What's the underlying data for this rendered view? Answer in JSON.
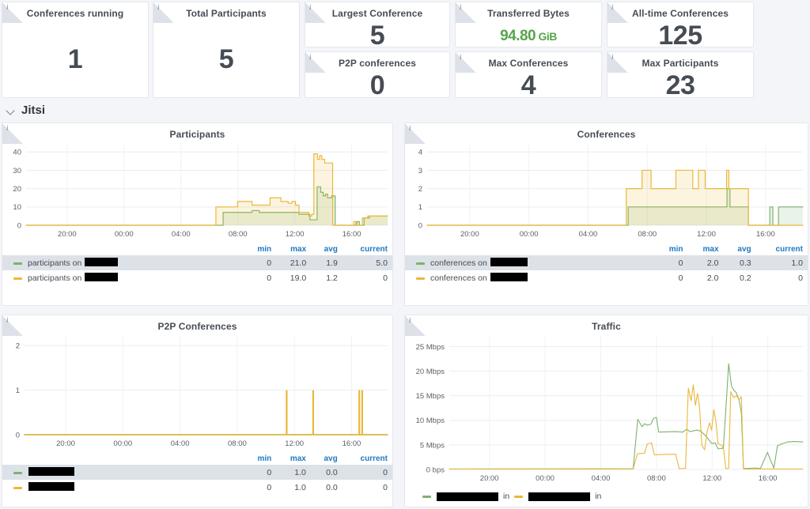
{
  "colors": {
    "series_green": "#7eb26d",
    "series_yellow": "#eab839",
    "accent_blue": "#1f78c1",
    "stat_green": "#56a64b",
    "text": "#464c54",
    "background": "#f4f5f8"
  },
  "stats": [
    {
      "title": "Conferences running",
      "value": "1",
      "unit": "",
      "color": "default",
      "info_icon": "info-icon"
    },
    {
      "title": "Total Participants",
      "value": "5",
      "unit": "",
      "color": "default",
      "info_icon": "info-icon"
    },
    {
      "title": "Largest Conference",
      "value": "5",
      "unit": "",
      "color": "default",
      "info_icon": "info-icon"
    },
    {
      "title": "P2P conferences",
      "value": "0",
      "unit": "",
      "color": "default",
      "info_icon": "info-icon"
    },
    {
      "title": "Transferred Bytes",
      "value": "94.80",
      "unit": "GiB",
      "color": "green",
      "info_icon": "info-icon"
    },
    {
      "title": "Max Conferences",
      "value": "4",
      "unit": "",
      "color": "default",
      "info_icon": "info-icon"
    },
    {
      "title": "All-time Conferences",
      "value": "125",
      "unit": "",
      "color": "default",
      "info_icon": "info-icon"
    },
    {
      "title": "Max Participants",
      "value": "23",
      "unit": "",
      "color": "default",
      "info_icon": "info-icon"
    }
  ],
  "row": {
    "title": "Jitsi",
    "chevron_icon": "chevron-down-icon",
    "expanded": true
  },
  "legend_headers": {
    "min": "min",
    "max": "max",
    "avg": "avg",
    "current": "current"
  },
  "panels": {
    "participants": {
      "title": "Participants",
      "legend": [
        {
          "label_prefix": "participants on ",
          "redacted": true,
          "redact_width": 42,
          "color": "#7eb26d",
          "min": "0",
          "max": "21.0",
          "avg": "1.9",
          "current": "5.0"
        },
        {
          "label_prefix": "participants on ",
          "redacted": true,
          "redact_width": 42,
          "color": "#eab839",
          "min": "0",
          "max": "19.0",
          "avg": "1.2",
          "current": "0"
        }
      ]
    },
    "conferences": {
      "title": "Conferences",
      "legend": [
        {
          "label_prefix": "conferences on ",
          "redacted": true,
          "redact_width": 47,
          "color": "#7eb26d",
          "min": "0",
          "max": "2.0",
          "avg": "0.3",
          "current": "1.0"
        },
        {
          "label_prefix": "conferences on ",
          "redacted": true,
          "redact_width": 47,
          "color": "#eab839",
          "min": "0",
          "max": "2.0",
          "avg": "0.2",
          "current": "0"
        }
      ]
    },
    "p2p": {
      "title": "P2P Conferences",
      "legend": [
        {
          "label_prefix": "",
          "redacted": true,
          "redact_width": 58,
          "color": "#7eb26d",
          "min": "0",
          "max": "1.0",
          "avg": "0.0",
          "current": "0"
        },
        {
          "label_prefix": "",
          "redacted": true,
          "redact_width": 58,
          "color": "#eab839",
          "min": "0",
          "max": "1.0",
          "avg": "0.0",
          "current": "0"
        }
      ]
    },
    "traffic": {
      "title": "Traffic",
      "legend_inline": [
        {
          "color": "#7eb26d",
          "redact_width": 78,
          "suffix": "in"
        },
        {
          "color": "#eab839",
          "redact_width": 78,
          "suffix": "in"
        }
      ]
    }
  },
  "chart_data": [
    {
      "type": "area",
      "title": "Participants",
      "xlabel": "",
      "ylabel": "",
      "ylim": [
        0,
        44
      ],
      "yticks": [
        "0",
        "10",
        "20",
        "30",
        "40"
      ],
      "ytick_values": [
        0,
        10,
        20,
        30,
        40
      ],
      "xticks": [
        "20:00",
        "00:00",
        "04:00",
        "08:00",
        "12:00",
        "16:00"
      ],
      "grid": true,
      "legend": "table-below",
      "series": [
        {
          "name": "participants on (redacted)",
          "color": "#7eb26d",
          "min": 0,
          "max": 21.0,
          "avg": 1.9,
          "current": 5.0,
          "points": [
            [
              0,
              0
            ],
            [
              0.52,
              0
            ],
            [
              0.545,
              7
            ],
            [
              0.6,
              7
            ],
            [
              0.625,
              8
            ],
            [
              0.645,
              7
            ],
            [
              0.7,
              7
            ],
            [
              0.745,
              7
            ],
            [
              0.755,
              6
            ],
            [
              0.775,
              6
            ],
            [
              0.785,
              3
            ],
            [
              0.795,
              3
            ],
            [
              0.805,
              21
            ],
            [
              0.815,
              18
            ],
            [
              0.822,
              16
            ],
            [
              0.828,
              17
            ],
            [
              0.834,
              15
            ],
            [
              0.845,
              16
            ],
            [
              0.855,
              0
            ],
            [
              0.9,
              0
            ],
            [
              0.915,
              2
            ],
            [
              0.922,
              0
            ],
            [
              0.935,
              4
            ],
            [
              0.95,
              5
            ],
            [
              1.0,
              5
            ]
          ]
        },
        {
          "name": "participants on (redacted)",
          "color": "#eab839",
          "min": 0,
          "max": 19.0,
          "avg": 1.2,
          "current": 0,
          "points": [
            [
              0,
              0
            ],
            [
              0.515,
              0
            ],
            [
              0.525,
              10
            ],
            [
              0.575,
              10
            ],
            [
              0.585,
              13
            ],
            [
              0.615,
              13
            ],
            [
              0.625,
              11
            ],
            [
              0.665,
              11
            ],
            [
              0.675,
              15
            ],
            [
              0.695,
              15
            ],
            [
              0.705,
              13
            ],
            [
              0.725,
              12
            ],
            [
              0.735,
              13
            ],
            [
              0.745,
              11
            ],
            [
              0.755,
              7
            ],
            [
              0.775,
              7
            ],
            [
              0.782,
              5
            ],
            [
              0.79,
              6
            ],
            [
              0.796,
              39
            ],
            [
              0.806,
              36
            ],
            [
              0.812,
              38
            ],
            [
              0.818,
              36
            ],
            [
              0.826,
              34
            ],
            [
              0.84,
              34
            ],
            [
              0.848,
              0
            ],
            [
              0.9,
              0
            ],
            [
              0.906,
              2
            ],
            [
              0.912,
              0
            ],
            [
              0.93,
              4
            ],
            [
              0.945,
              5
            ],
            [
              1.0,
              5
            ]
          ]
        }
      ]
    },
    {
      "type": "area",
      "title": "Conferences",
      "ylim": [
        0,
        4.4
      ],
      "yticks": [
        "0",
        "1",
        "2",
        "3",
        "4"
      ],
      "ytick_values": [
        0,
        1,
        2,
        3,
        4
      ],
      "xticks": [
        "20:00",
        "00:00",
        "04:00",
        "08:00",
        "12:00",
        "16:00"
      ],
      "grid": true,
      "legend": "table-below",
      "series": [
        {
          "name": "conferences on (redacted)",
          "color": "#7eb26d",
          "min": 0,
          "max": 2.0,
          "avg": 0.3,
          "current": 1.0,
          "points": [
            [
              0,
              0
            ],
            [
              0.525,
              0
            ],
            [
              0.535,
              1
            ],
            [
              0.79,
              1
            ],
            [
              0.798,
              2
            ],
            [
              0.806,
              1
            ],
            [
              0.848,
              1
            ],
            [
              0.855,
              0
            ],
            [
              0.905,
              0
            ],
            [
              0.912,
              1
            ],
            [
              0.92,
              0
            ],
            [
              0.935,
              1
            ],
            [
              1.0,
              1
            ]
          ]
        },
        {
          "name": "conferences on (redacted)",
          "color": "#eab839",
          "min": 0,
          "max": 2.0,
          "avg": 0.2,
          "current": 0,
          "points": [
            [
              0,
              0
            ],
            [
              0.52,
              0
            ],
            [
              0.53,
              2
            ],
            [
              0.565,
              2
            ],
            [
              0.572,
              3
            ],
            [
              0.588,
              3
            ],
            [
              0.596,
              2
            ],
            [
              0.655,
              2
            ],
            [
              0.662,
              3
            ],
            [
              0.7,
              3
            ],
            [
              0.707,
              2
            ],
            [
              0.715,
              2
            ],
            [
              0.722,
              3
            ],
            [
              0.733,
              3
            ],
            [
              0.74,
              2
            ],
            [
              0.79,
              2
            ],
            [
              0.797,
              3
            ],
            [
              0.803,
              2
            ],
            [
              0.848,
              2
            ],
            [
              0.855,
              0
            ],
            [
              1.0,
              0
            ]
          ]
        }
      ]
    },
    {
      "type": "line",
      "title": "P2P Conferences",
      "ylim": [
        0,
        2.2
      ],
      "yticks": [
        "0",
        "1",
        "2"
      ],
      "ytick_values": [
        0,
        1,
        2
      ],
      "xticks": [
        "20:00",
        "00:00",
        "04:00",
        "08:00",
        "12:00",
        "16:00"
      ],
      "grid": true,
      "legend": "table-below",
      "series": [
        {
          "name": "(redacted)",
          "color": "#7eb26d",
          "min": 0,
          "max": 1.0,
          "avg": 0.0,
          "current": 0,
          "points": [
            [
              0,
              0
            ],
            [
              1,
              0
            ]
          ]
        },
        {
          "name": "(redacted)",
          "color": "#eab839",
          "min": 0,
          "max": 1.0,
          "avg": 0.0,
          "current": 0,
          "spikes": [
            0.722,
            0.795,
            0.922,
            0.93
          ]
        }
      ]
    },
    {
      "type": "line",
      "title": "Traffic",
      "ylim": [
        0,
        27
      ],
      "yticks": [
        "0 bps",
        "5 Mbps",
        "10 Mbps",
        "15 Mbps",
        "20 Mbps",
        "25 Mbps"
      ],
      "ytick_values": [
        0,
        5,
        10,
        15,
        20,
        25
      ],
      "unit": "Mbps",
      "xticks": [
        "20:00",
        "00:00",
        "04:00",
        "08:00",
        "12:00",
        "16:00"
      ],
      "grid": true,
      "legend": "inline-below",
      "series": [
        {
          "name": "(redacted) in",
          "color": "#7eb26d",
          "points": [
            [
              0,
              0.1
            ],
            [
              0.52,
              0.15
            ],
            [
              0.533,
              10.2
            ],
            [
              0.545,
              8.7
            ],
            [
              0.552,
              9.3
            ],
            [
              0.56,
              9.0
            ],
            [
              0.57,
              9.2
            ],
            [
              0.578,
              10.4
            ],
            [
              0.586,
              10.6
            ],
            [
              0.592,
              7.6
            ],
            [
              0.64,
              7.7
            ],
            [
              0.66,
              7.6
            ],
            [
              0.672,
              8.2
            ],
            [
              0.68,
              7.7
            ],
            [
              0.7,
              8.0
            ],
            [
              0.712,
              7.8
            ],
            [
              0.728,
              6.6
            ],
            [
              0.742,
              5.3
            ],
            [
              0.752,
              5.4
            ],
            [
              0.76,
              4.2
            ],
            [
              0.775,
              4.3
            ],
            [
              0.782,
              12.0
            ],
            [
              0.79,
              21.5
            ],
            [
              0.798,
              17.0
            ],
            [
              0.806,
              16.0
            ],
            [
              0.812,
              15.6
            ],
            [
              0.82,
              14.0
            ],
            [
              0.826,
              11.5
            ],
            [
              0.832,
              0.2
            ],
            [
              0.868,
              0.3
            ],
            [
              0.88,
              0.2
            ],
            [
              0.9,
              3.5
            ],
            [
              0.908,
              2.0
            ],
            [
              0.918,
              0.3
            ],
            [
              0.928,
              4.8
            ],
            [
              0.94,
              5.2
            ],
            [
              0.958,
              5.6
            ],
            [
              0.975,
              5.7
            ],
            [
              1.0,
              5.6
            ]
          ]
        },
        {
          "name": "(redacted) in",
          "color": "#eab839",
          "points": [
            [
              0,
              0.08
            ],
            [
              0.52,
              0.1
            ],
            [
              0.532,
              3.2
            ],
            [
              0.552,
              3.3
            ],
            [
              0.56,
              5.2
            ],
            [
              0.572,
              5.4
            ],
            [
              0.58,
              3.0
            ],
            [
              0.64,
              3.1
            ],
            [
              0.65,
              0.2
            ],
            [
              0.668,
              0.2
            ],
            [
              0.676,
              16.5
            ],
            [
              0.684,
              14.0
            ],
            [
              0.69,
              17.2
            ],
            [
              0.696,
              13.0
            ],
            [
              0.702,
              15.5
            ],
            [
              0.708,
              12.5
            ],
            [
              0.714,
              5.0
            ],
            [
              0.722,
              4.0
            ],
            [
              0.73,
              8.0
            ],
            [
              0.736,
              9.5
            ],
            [
              0.742,
              8.0
            ],
            [
              0.748,
              12.2
            ],
            [
              0.754,
              9.8
            ],
            [
              0.76,
              5.2
            ],
            [
              0.77,
              5.0
            ],
            [
              0.776,
              4.0
            ],
            [
              0.782,
              0.2
            ],
            [
              0.79,
              0.2
            ],
            [
              0.796,
              15.8
            ],
            [
              0.804,
              14.6
            ],
            [
              0.812,
              15.0
            ],
            [
              0.82,
              14.2
            ],
            [
              0.826,
              14.8
            ],
            [
              0.832,
              0.1
            ],
            [
              1.0,
              0.1
            ]
          ]
        }
      ]
    }
  ]
}
